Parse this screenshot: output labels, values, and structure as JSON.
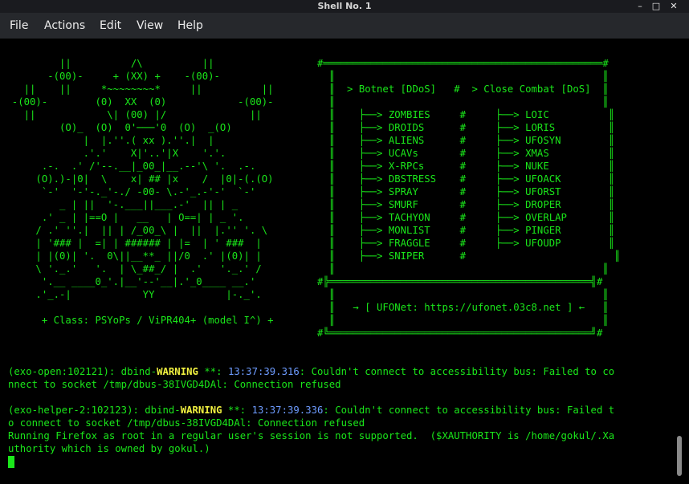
{
  "window": {
    "title": "Shell No. 1",
    "minimize": "–",
    "maximize": "□",
    "close": "✕"
  },
  "menubar": {
    "items": [
      "File",
      "Actions",
      "Edit",
      "View",
      "Help"
    ]
  },
  "banner": {
    "left": [
      "          ||          /\\          ||",
      "        -(00)-     + (XX) +    -(00)-",
      "    ||    ||     *~~~~~~~~*     ||          ||",
      "  -(00)-        (0)  XX  (0)            -(00)-",
      "    ||            \\| (00) |/              ||",
      "          (O)_  (O)  0'───'0  (O)  _(O)",
      "              |  |.''.( xx ).''.|  |",
      "              .'.'    X|'..'|X    '.'.",
      "       .-.  .' /'--.__|_00_|__.--'\\ '.  .-.",
      "      (O).)-|0|  \\    x| ## |x    /  |0|-(.(O)",
      "       `-'  '-'-._'-./ -00- \\.-'_.-'-'  `-'",
      "          _ | ||  '-.___||___.-'  || | _",
      "       .' _ | |==O |   __   | O==| | _ '.",
      "      / .' ''.|  || | /_00_\\ |  ||  |.'' '. \\",
      "      | '### |  =| | ###### | |=  | ' ###  |",
      "      | |(0)| '.  0\\||__**_ ||/0  .' |(0)| |",
      "      \\ '._.'   '.  | \\_##_/ |  .'   '._.' /",
      "       '.__ ____0_'.|__'--'__|.'_0____ __.'",
      "      .'_.-|            YY            |-._'.",
      "",
      "       + Class: PSYoPs / ViPR404+ (model I^) +"
    ],
    "right": [
      "#═══════════════════════════════════════════════#",
      "  ║                                             ║",
      "  ║  > Botnet [DDoS]   #  > Close Combat [DoS]  ║",
      "  ║                                             ║",
      "  ║    ├──> ZOMBIES     #     ├──> LOIC          ║",
      "  ║    ├──> DROIDS      #     ├──> LORIS         ║",
      "  ║    ├──> ALIENS      #     ├──> UFOSYN        ║",
      "  ║    ├──> UCAVs       #     ├──> XMAS          ║",
      "  ║    ├──> X-RPCs      #     ├──> NUKE          ║",
      "  ║    ├──> DBSTRESS    #     ├──> UFOACK        ║",
      "  ║    ├──> SPRAY       #     ├──> UFORST        ║",
      "  ║    ├──> SMURF       #     ├──> DROPER        ║",
      "  ║    ├──> TACHYON     #     ├──> OVERLAP       ║",
      "  ║    ├──> MONLIST     #     ├──> PINGER        ║",
      "  ║    ├──> FRAGGLE     #     ├──> UFOUDP        ║",
      "  ║    ├──> SNIPER      #                         ║",
      "  ║                                             ║",
      "#╠════════════════════════════════════════════╣#",
      "  ║                                             ║",
      "  ║   → [ UFONet: https://ufonet.03c8.net ] ←   ║",
      "  ║                                             ║",
      "#╚════════════════════════════════════════════╝#"
    ]
  },
  "log": {
    "l1a": "(exo-open:102121): dbind-",
    "warn1": "WARNING",
    "l1b": " **: ",
    "time1": "13:37:39.316",
    "l1c": ": Couldn't connect to accessibility bus: Failed to co",
    "l2": "nnect to socket /tmp/dbus-38IVGD4DAl: Connection refused",
    "l3a": "(exo-helper-2:102123): dbind-",
    "warn2": "WARNING",
    "l3b": " **: ",
    "time2": "13:37:39.336",
    "l3c": ": Couldn't connect to accessibility bus: Failed t",
    "l4": "o connect to socket /tmp/dbus-38IVGD4DAl: Connection refused",
    "l5": "Running Firefox as root in a regular user's session is not supported.  ($XAUTHORITY is /home/gokul/.Xa",
    "l6": "uthority which is owned by gokul.)"
  },
  "colors": {
    "text": "#1ae61a",
    "warning": "#f0f040",
    "timestamp": "#6e9cff",
    "background": "#000000"
  }
}
